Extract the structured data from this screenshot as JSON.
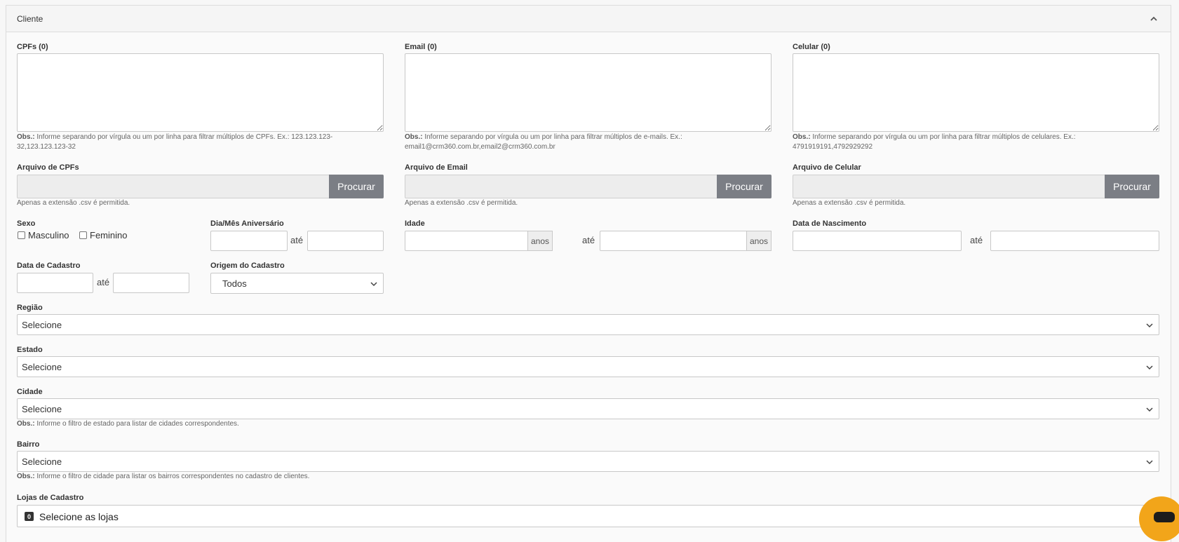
{
  "panel": {
    "title": "Cliente"
  },
  "cpfs": {
    "label": "CPFs (0)",
    "obs_strong": "Obs.:",
    "obs_text": "Informe separando por vírgula ou um por linha para filtrar múltiplos de CPFs. Ex.: 123.123.123-32,123.123.123-32",
    "file_label": "Arquivo de CPFs",
    "file_button": "Procurar",
    "file_note": "Apenas a extensão .csv é permitida."
  },
  "email": {
    "label": "Email (0)",
    "obs_strong": "Obs.:",
    "obs_text": "Informe separando por vírgula ou um por linha para filtrar múltiplos de e-mails. Ex.: email1@crm360.com.br,email2@crm360.com.br",
    "file_label": "Arquivo de Email",
    "file_button": "Procurar",
    "file_note": "Apenas a extensão .csv é permitida."
  },
  "celular": {
    "label": "Celular (0)",
    "obs_strong": "Obs.:",
    "obs_text": "Informe separando por vírgula ou um por linha para filtrar múltiplos de celulares. Ex.: 4791919191,4792929292",
    "file_label": "Arquivo de Celular",
    "file_button": "Procurar",
    "file_note": "Apenas a extensão .csv é permitida."
  },
  "sexo": {
    "label": "Sexo",
    "masculino": "Masculino",
    "feminino": "Feminino"
  },
  "aniversario": {
    "label": "Dia/Mês Aniversário",
    "ate": "até"
  },
  "idade": {
    "label": "Idade",
    "unit": "anos",
    "ate": "até"
  },
  "nascimento": {
    "label": "Data de Nascimento",
    "ate": "até"
  },
  "cadastro": {
    "label": "Data de Cadastro",
    "ate": "até"
  },
  "origem": {
    "label": "Origem do Cadastro",
    "value": "Todos"
  },
  "regiao": {
    "label": "Região",
    "value": "Selecione"
  },
  "estado": {
    "label": "Estado",
    "value": "Selecione"
  },
  "cidade": {
    "label": "Cidade",
    "value": "Selecione",
    "obs_strong": "Obs.:",
    "obs_text": "Informe o filtro de estado para listar de cidades correspondentes."
  },
  "bairro": {
    "label": "Bairro",
    "value": "Selecione",
    "obs_strong": "Obs.:",
    "obs_text": "Informe o filtro de cidade para listar os bairros correspondentes no cadastro de clientes."
  },
  "lojas": {
    "label": "Lojas de Cadastro",
    "badge": "0",
    "placeholder": "Selecione as lojas"
  },
  "icons": {
    "collapse": "chevron-up-icon",
    "select": "chevron-down-icon",
    "chat": "chat-bubble-icon"
  }
}
